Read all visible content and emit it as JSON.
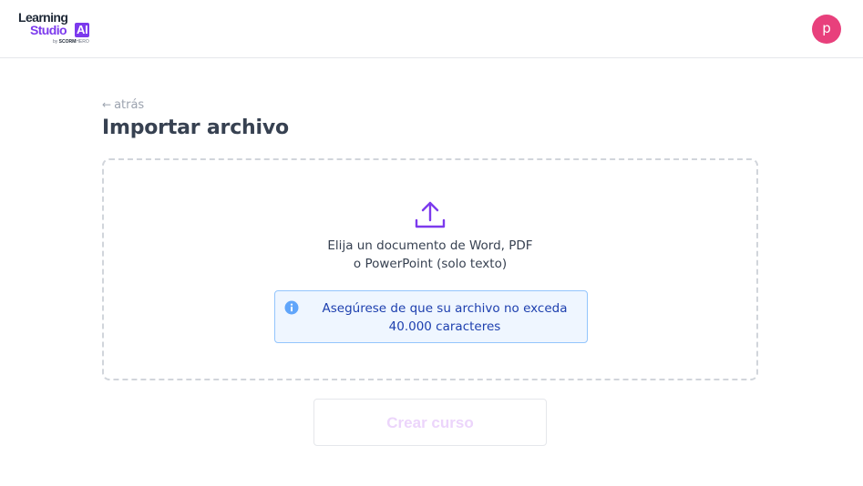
{
  "header": {
    "logo": {
      "line1": "Learning",
      "line2": "Studio",
      "badge": "AI",
      "byline_prefix": "by",
      "byline_brand": "SCORM",
      "byline_suffix": "HERO"
    },
    "user_initial": "p",
    "avatar_color": "#e8407c"
  },
  "back_link": {
    "icon": "arrow-left-icon",
    "label": "atrás"
  },
  "page_title": "Importar archivo",
  "dropzone": {
    "icon": "upload-icon",
    "icon_color": "#7c3aed",
    "line1": "Elija un documento de Word, PDF",
    "line2": "o PowerPoint (solo texto)",
    "notice": {
      "icon": "info-icon",
      "line1": "Asegúrese de que su archivo no exceda",
      "line2": "40.000 caracteres"
    }
  },
  "create_button": {
    "label": "Crear curso",
    "state": "disabled"
  }
}
